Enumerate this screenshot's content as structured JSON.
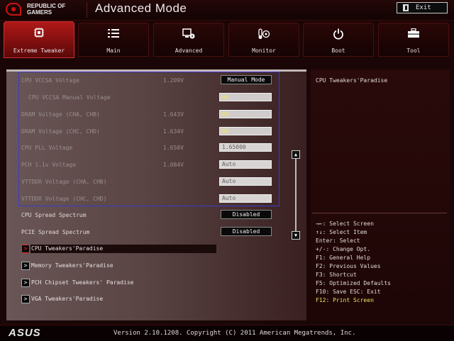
{
  "header": {
    "logo_text": "REPUBLIC OF GAMERS",
    "logo_line1": "REPUBLIC OF",
    "logo_line2": "GAMERS",
    "title": "Advanced Mode",
    "exit_label": "Exit"
  },
  "tabs": [
    {
      "label": "Extreme Tweaker",
      "icon": "cpu-chip-icon",
      "active": true
    },
    {
      "label": "Main",
      "icon": "list-icon",
      "active": false
    },
    {
      "label": "Advanced",
      "icon": "advanced-settings-icon",
      "active": false
    },
    {
      "label": "Monitor",
      "icon": "thermometer-fan-icon",
      "active": false
    },
    {
      "label": "Boot",
      "icon": "power-icon",
      "active": false
    },
    {
      "label": "Tool",
      "icon": "toolbox-icon",
      "active": false
    }
  ],
  "settings": [
    {
      "label": "CPU VCCSA Voltage",
      "value": "1.209V",
      "control": "Manual Mode"
    },
    {
      "label": "CPU VCCSA Manual Voltage",
      "value": "",
      "control": ""
    },
    {
      "label": "DRAM Voltage (CHA, CHB)",
      "value": "1.643V",
      "control": ""
    },
    {
      "label": "DRAM Voltage (CHC, CHD)",
      "value": "1.634V",
      "control": ""
    },
    {
      "label": "CPU PLL Voltage",
      "value": "1.650V",
      "control": "1.65000"
    },
    {
      "label": "PCH 1.1v Voltage",
      "value": "1.084V",
      "control": "Auto"
    },
    {
      "label": "VTTDDR Voltage (CHA, CHB)",
      "value": "",
      "control": "Auto"
    },
    {
      "label": "VTTDDR Voltage (CHC, CHD)",
      "value": "",
      "control": "Auto"
    },
    {
      "label": "CPU Spread Spectrum",
      "value": "",
      "control": "Disabled"
    },
    {
      "label": "PCIE Spread Spectrum",
      "value": "",
      "control": "Disabled"
    }
  ],
  "submenus": [
    {
      "label": "CPU Tweakers'Paradise",
      "active": true
    },
    {
      "label": "Memory Tweakers'Paradise",
      "active": false
    },
    {
      "label": "PCH Chipset Tweakers' Paradise",
      "active": false
    },
    {
      "label": "VGA Tweakers'Paradise",
      "active": false
    }
  ],
  "help": {
    "title": "CPU Tweakers'Paradise",
    "keys": [
      "→←: Select Screen",
      "↑↓: Select Item",
      "Enter: Select",
      "+/-: Change Opt.",
      "F1: General Help",
      "F2: Previous Values",
      "F3: Shortcut",
      "F5: Optimized Defaults",
      "F10: Save  ESC: Exit",
      "F12: Print Screen"
    ]
  },
  "footer": {
    "brand": "ASUS",
    "version": "Version 2.10.1208. Copyright (C) 2011 American Megatrends, Inc."
  },
  "colors": {
    "accent": "#c01818",
    "selection_border": "#3a3ad0",
    "help_highlight": "#e8e060"
  }
}
